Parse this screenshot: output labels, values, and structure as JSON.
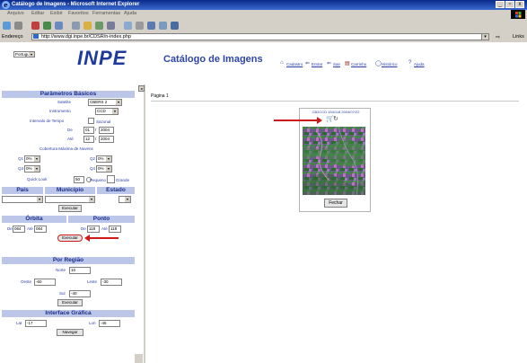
{
  "window": {
    "title": "Catálogo de Imagens - Microsoft Internet Explorer",
    "controls": [
      "_",
      "▫",
      "x"
    ]
  },
  "menu": [
    "Arquivo",
    "Editar",
    "Exibir",
    "Favoritos",
    "Ferramentas",
    "Ajuda"
  ],
  "address": {
    "label": "Endereço",
    "url": "http://www.dgi.inpe.br/CDSR/n-index.php",
    "go": "⇨",
    "links": "Links"
  },
  "header": {
    "language": "Português",
    "logo": "INPE",
    "title": "Catálogo de Imagens",
    "nav": [
      {
        "icon": "⌂",
        "label": "Cadastro"
      },
      {
        "icon": "⇐",
        "label": "Entrar"
      },
      {
        "icon": "⇐",
        "label": "Sair"
      },
      {
        "icon": "▤",
        "label": "Carrinho"
      },
      {
        "icon": "◯",
        "label": "Histórico"
      },
      {
        "icon": "?",
        "label": "Ajuda"
      }
    ]
  },
  "params": {
    "heading": "Parâmetros Básicos",
    "satelite_label": "Satelite",
    "satelite_value": "CBERS 2",
    "instrumento_label": "Instrumento",
    "instrumento_value": "CCD",
    "intervalo_label": "Intervalo de Tempo",
    "sazonal_label": "Sazonal",
    "de_label": "De",
    "de_day": "01",
    "de_year": "2004",
    "ate_label": "Até",
    "ate_day": "12",
    "ate_year": "2004",
    "cobertura_label": "Cobertura Máxima de Nuvens",
    "q1": "Q1",
    "q1_value": "0%",
    "q2": "Q2",
    "q2_value": "0%",
    "q3": "Q3",
    "q3_value": "0%",
    "q4": "Q4",
    "q4_value": "0%",
    "quicklook_label": "Quick Look",
    "quicklook_value": "50",
    "pequeno_label": "Pequeno",
    "grande_label": "Grande"
  },
  "region": {
    "pais": "País",
    "municipio": "Município",
    "estado": "Estado",
    "execute": "Executar"
  },
  "orbit": {
    "orbita": "Órbita",
    "ponto": "Ponto",
    "de_label": "De",
    "orb_de": "064",
    "ate_label": "Até",
    "orb_ate": "064",
    "pt_de_label": "De",
    "pt_de": "118",
    "pt_ate_label": "Até",
    "pt_ate": "118",
    "execute": "Executar"
  },
  "porregiao": {
    "heading": "Por Região",
    "norte_label": "Norte",
    "norte": "10",
    "oeste_label": "Oeste",
    "oeste": "-60",
    "leste_label": "Leste",
    "leste": "-30",
    "sul_label": "Sul",
    "sul": "-40",
    "execute": "Executar"
  },
  "interface": {
    "heading": "Interface Gráfica",
    "lat_label": "Lat",
    "lat": "-17",
    "lon_label": "Lon",
    "lon": "-45",
    "navegar": "Navegar"
  },
  "content": {
    "pagina": "Página 1",
    "image_caption": "CB2CCD 154/118 2004/07/22",
    "fechar": "Fechar"
  },
  "colors": {
    "accent": "#2d46a8",
    "section_bg": "#bcc6e8",
    "arrow": "#d01a1a"
  }
}
